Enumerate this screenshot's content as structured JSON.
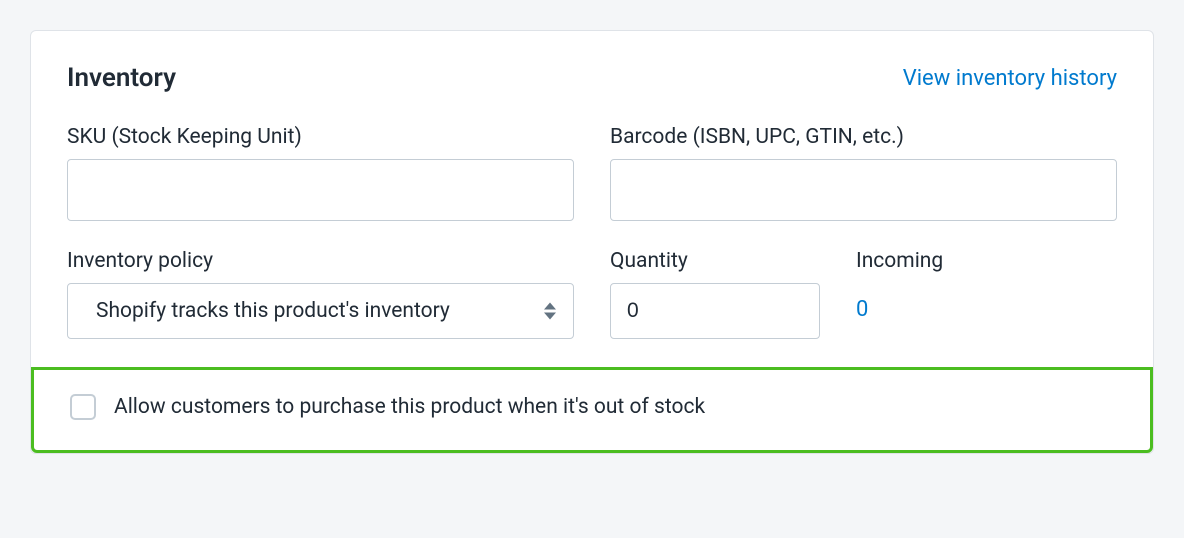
{
  "card": {
    "title": "Inventory",
    "link": "View inventory history"
  },
  "fields": {
    "sku": {
      "label": "SKU (Stock Keeping Unit)",
      "value": ""
    },
    "barcode": {
      "label": "Barcode (ISBN, UPC, GTIN, etc.)",
      "value": ""
    },
    "inventory_policy": {
      "label": "Inventory policy",
      "selected": "Shopify tracks this product's inventory"
    },
    "quantity": {
      "label": "Quantity",
      "value": "0"
    },
    "incoming": {
      "label": "Incoming",
      "value": "0"
    }
  },
  "checkbox": {
    "label": "Allow customers to purchase this product when it's out of stock",
    "checked": false
  }
}
